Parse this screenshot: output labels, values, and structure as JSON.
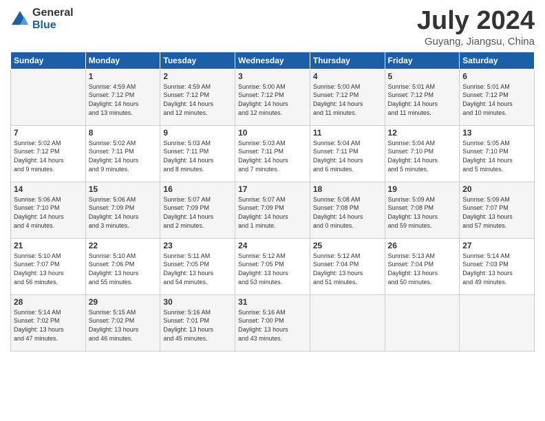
{
  "header": {
    "logo_general": "General",
    "logo_blue": "Blue",
    "month_title": "July 2024",
    "location": "Guyang, Jiangsu, China"
  },
  "days_of_week": [
    "Sunday",
    "Monday",
    "Tuesday",
    "Wednesday",
    "Thursday",
    "Friday",
    "Saturday"
  ],
  "weeks": [
    [
      {
        "day": "",
        "info": ""
      },
      {
        "day": "1",
        "info": "Sunrise: 4:59 AM\nSunset: 7:12 PM\nDaylight: 14 hours\nand 13 minutes."
      },
      {
        "day": "2",
        "info": "Sunrise: 4:59 AM\nSunset: 7:12 PM\nDaylight: 14 hours\nand 12 minutes."
      },
      {
        "day": "3",
        "info": "Sunrise: 5:00 AM\nSunset: 7:12 PM\nDaylight: 14 hours\nand 12 minutes."
      },
      {
        "day": "4",
        "info": "Sunrise: 5:00 AM\nSunset: 7:12 PM\nDaylight: 14 hours\nand 11 minutes."
      },
      {
        "day": "5",
        "info": "Sunrise: 5:01 AM\nSunset: 7:12 PM\nDaylight: 14 hours\nand 11 minutes."
      },
      {
        "day": "6",
        "info": "Sunrise: 5:01 AM\nSunset: 7:12 PM\nDaylight: 14 hours\nand 10 minutes."
      }
    ],
    [
      {
        "day": "7",
        "info": "Sunrise: 5:02 AM\nSunset: 7:12 PM\nDaylight: 14 hours\nand 9 minutes."
      },
      {
        "day": "8",
        "info": "Sunrise: 5:02 AM\nSunset: 7:11 PM\nDaylight: 14 hours\nand 9 minutes."
      },
      {
        "day": "9",
        "info": "Sunrise: 5:03 AM\nSunset: 7:11 PM\nDaylight: 14 hours\nand 8 minutes."
      },
      {
        "day": "10",
        "info": "Sunrise: 5:03 AM\nSunset: 7:11 PM\nDaylight: 14 hours\nand 7 minutes."
      },
      {
        "day": "11",
        "info": "Sunrise: 5:04 AM\nSunset: 7:11 PM\nDaylight: 14 hours\nand 6 minutes."
      },
      {
        "day": "12",
        "info": "Sunrise: 5:04 AM\nSunset: 7:10 PM\nDaylight: 14 hours\nand 5 minutes."
      },
      {
        "day": "13",
        "info": "Sunrise: 5:05 AM\nSunset: 7:10 PM\nDaylight: 14 hours\nand 5 minutes."
      }
    ],
    [
      {
        "day": "14",
        "info": "Sunrise: 5:06 AM\nSunset: 7:10 PM\nDaylight: 14 hours\nand 4 minutes."
      },
      {
        "day": "15",
        "info": "Sunrise: 5:06 AM\nSunset: 7:09 PM\nDaylight: 14 hours\nand 3 minutes."
      },
      {
        "day": "16",
        "info": "Sunrise: 5:07 AM\nSunset: 7:09 PM\nDaylight: 14 hours\nand 2 minutes."
      },
      {
        "day": "17",
        "info": "Sunrise: 5:07 AM\nSunset: 7:09 PM\nDaylight: 14 hours\nand 1 minute."
      },
      {
        "day": "18",
        "info": "Sunrise: 5:08 AM\nSunset: 7:08 PM\nDaylight: 14 hours\nand 0 minutes."
      },
      {
        "day": "19",
        "info": "Sunrise: 5:09 AM\nSunset: 7:08 PM\nDaylight: 13 hours\nand 59 minutes."
      },
      {
        "day": "20",
        "info": "Sunrise: 5:09 AM\nSunset: 7:07 PM\nDaylight: 13 hours\nand 57 minutes."
      }
    ],
    [
      {
        "day": "21",
        "info": "Sunrise: 5:10 AM\nSunset: 7:07 PM\nDaylight: 13 hours\nand 56 minutes."
      },
      {
        "day": "22",
        "info": "Sunrise: 5:10 AM\nSunset: 7:06 PM\nDaylight: 13 hours\nand 55 minutes."
      },
      {
        "day": "23",
        "info": "Sunrise: 5:11 AM\nSunset: 7:05 PM\nDaylight: 13 hours\nand 54 minutes."
      },
      {
        "day": "24",
        "info": "Sunrise: 5:12 AM\nSunset: 7:05 PM\nDaylight: 13 hours\nand 53 minutes."
      },
      {
        "day": "25",
        "info": "Sunrise: 5:12 AM\nSunset: 7:04 PM\nDaylight: 13 hours\nand 51 minutes."
      },
      {
        "day": "26",
        "info": "Sunrise: 5:13 AM\nSunset: 7:04 PM\nDaylight: 13 hours\nand 50 minutes."
      },
      {
        "day": "27",
        "info": "Sunrise: 5:14 AM\nSunset: 7:03 PM\nDaylight: 13 hours\nand 49 minutes."
      }
    ],
    [
      {
        "day": "28",
        "info": "Sunrise: 5:14 AM\nSunset: 7:02 PM\nDaylight: 13 hours\nand 47 minutes."
      },
      {
        "day": "29",
        "info": "Sunrise: 5:15 AM\nSunset: 7:02 PM\nDaylight: 13 hours\nand 46 minutes."
      },
      {
        "day": "30",
        "info": "Sunrise: 5:16 AM\nSunset: 7:01 PM\nDaylight: 13 hours\nand 45 minutes."
      },
      {
        "day": "31",
        "info": "Sunrise: 5:16 AM\nSunset: 7:00 PM\nDaylight: 13 hours\nand 43 minutes."
      },
      {
        "day": "",
        "info": ""
      },
      {
        "day": "",
        "info": ""
      },
      {
        "day": "",
        "info": ""
      }
    ]
  ]
}
